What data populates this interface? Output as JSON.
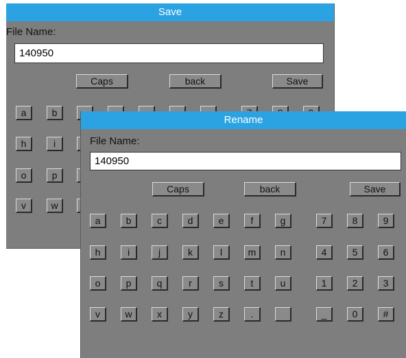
{
  "save_dialog": {
    "title": "Save",
    "file_name_label": "File Name:",
    "file_name_value": "140950",
    "caps": "Caps",
    "back": "back",
    "save": "Save",
    "keys_col1": [
      "a",
      "h",
      "o",
      "v"
    ],
    "keys_col2": [
      "b",
      "i",
      "p",
      "w"
    ],
    "row1_right": [
      "7",
      "8",
      "9"
    ]
  },
  "rename_dialog": {
    "title": "Rename",
    "file_name_label": "File Name:",
    "file_name_value": "140950",
    "caps": "Caps",
    "back": "back",
    "save": "Save",
    "rows": [
      [
        "a",
        "b",
        "c",
        "d",
        "e",
        "f",
        "g",
        "7",
        "8",
        "9"
      ],
      [
        "h",
        "i",
        "j",
        "k",
        "l",
        "m",
        "n",
        "4",
        "5",
        "6"
      ],
      [
        "o",
        "p",
        "q",
        "r",
        "s",
        "t",
        "u",
        "1",
        "2",
        "3"
      ],
      [
        "v",
        "w",
        "x",
        "y",
        "z",
        ".",
        "",
        "_",
        "0",
        "#"
      ]
    ]
  },
  "colors": {
    "title_bar": "#2ba3e3",
    "panel": "#7e7e7e",
    "key": "#8a8a8a"
  }
}
